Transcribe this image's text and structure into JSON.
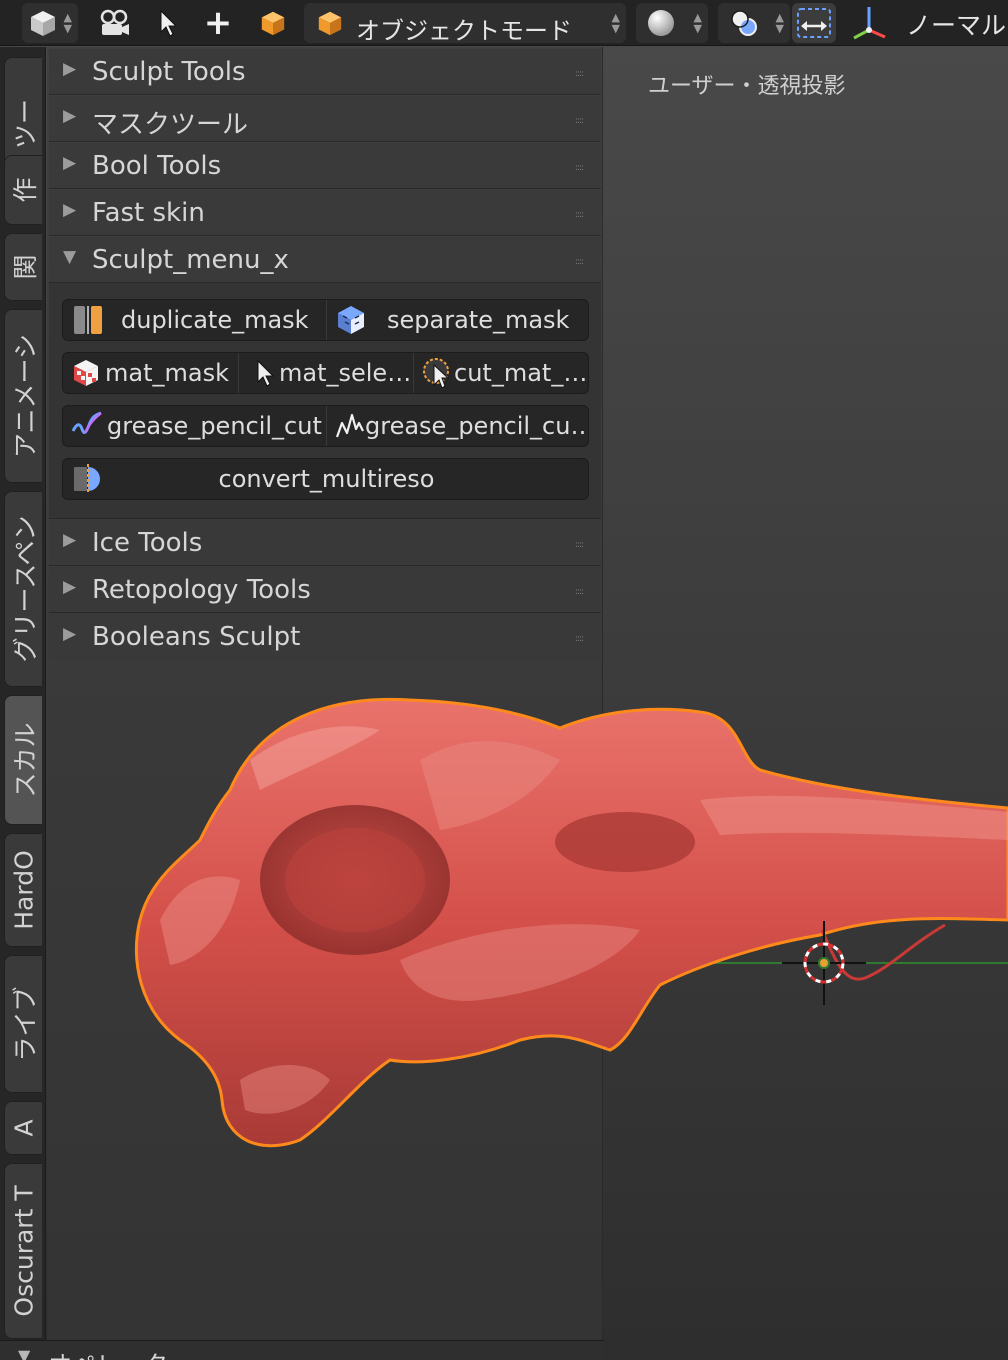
{
  "header": {
    "editor_type_icon": "cube-view3d-icon",
    "camera_icon": "camera-film-icon",
    "select_icon": "cursor-arrow-icon",
    "add_icon": "plus-icon",
    "object_icon": "orange-cube-icon",
    "mode_label": "オブジェクトモード",
    "shading_icon": "white-sphere-icon",
    "overlay_icon": "overlay-circles-icon",
    "transform_icon": "transform-arrows-icon",
    "gizmo_icon": "xyz-axes-icon",
    "orientation_label": "ノーマル"
  },
  "tabs": [
    {
      "label": "ツー"
    },
    {
      "label": "作"
    },
    {
      "label": "関"
    },
    {
      "label": "アニメーシ"
    },
    {
      "label": "グリースペン"
    },
    {
      "label": "スカル"
    },
    {
      "label": "HardO"
    },
    {
      "label": "ライブ"
    },
    {
      "label": "A"
    },
    {
      "label": "Oscurart T"
    }
  ],
  "panels": {
    "sculpt_tools": "Sculpt Tools",
    "mask_tools": "マスクツール",
    "bool_tools": "Bool Tools",
    "fast_skin": "Fast skin",
    "sculpt_menu_x": "Sculpt_menu_x",
    "ice_tools": "Ice Tools",
    "retopology_tools": "Retopology Tools",
    "booleans_sculpt": "Booleans Sculpt"
  },
  "sculpt_menu": {
    "duplicate_mask": "duplicate_mask",
    "separate_mask": "separate_mask",
    "mat_mask": "mat_mask",
    "mat_select": "mat_sele…",
    "cut_mat": "cut_mat_…",
    "grease_pencil_cut": "grease_pencil_cut",
    "grease_pencil_cut2": "grease_pencil_cu…",
    "convert_multireso": "convert_multireso"
  },
  "viewport": {
    "label": "ユーザー・透視投影"
  },
  "operator_panel": {
    "label": "オペレーター"
  },
  "colors": {
    "selection_outline": "#ff8a1c",
    "mesh": "#d4504a",
    "x_axis_line": "#2f7a2f",
    "header_bg": "#232323"
  }
}
